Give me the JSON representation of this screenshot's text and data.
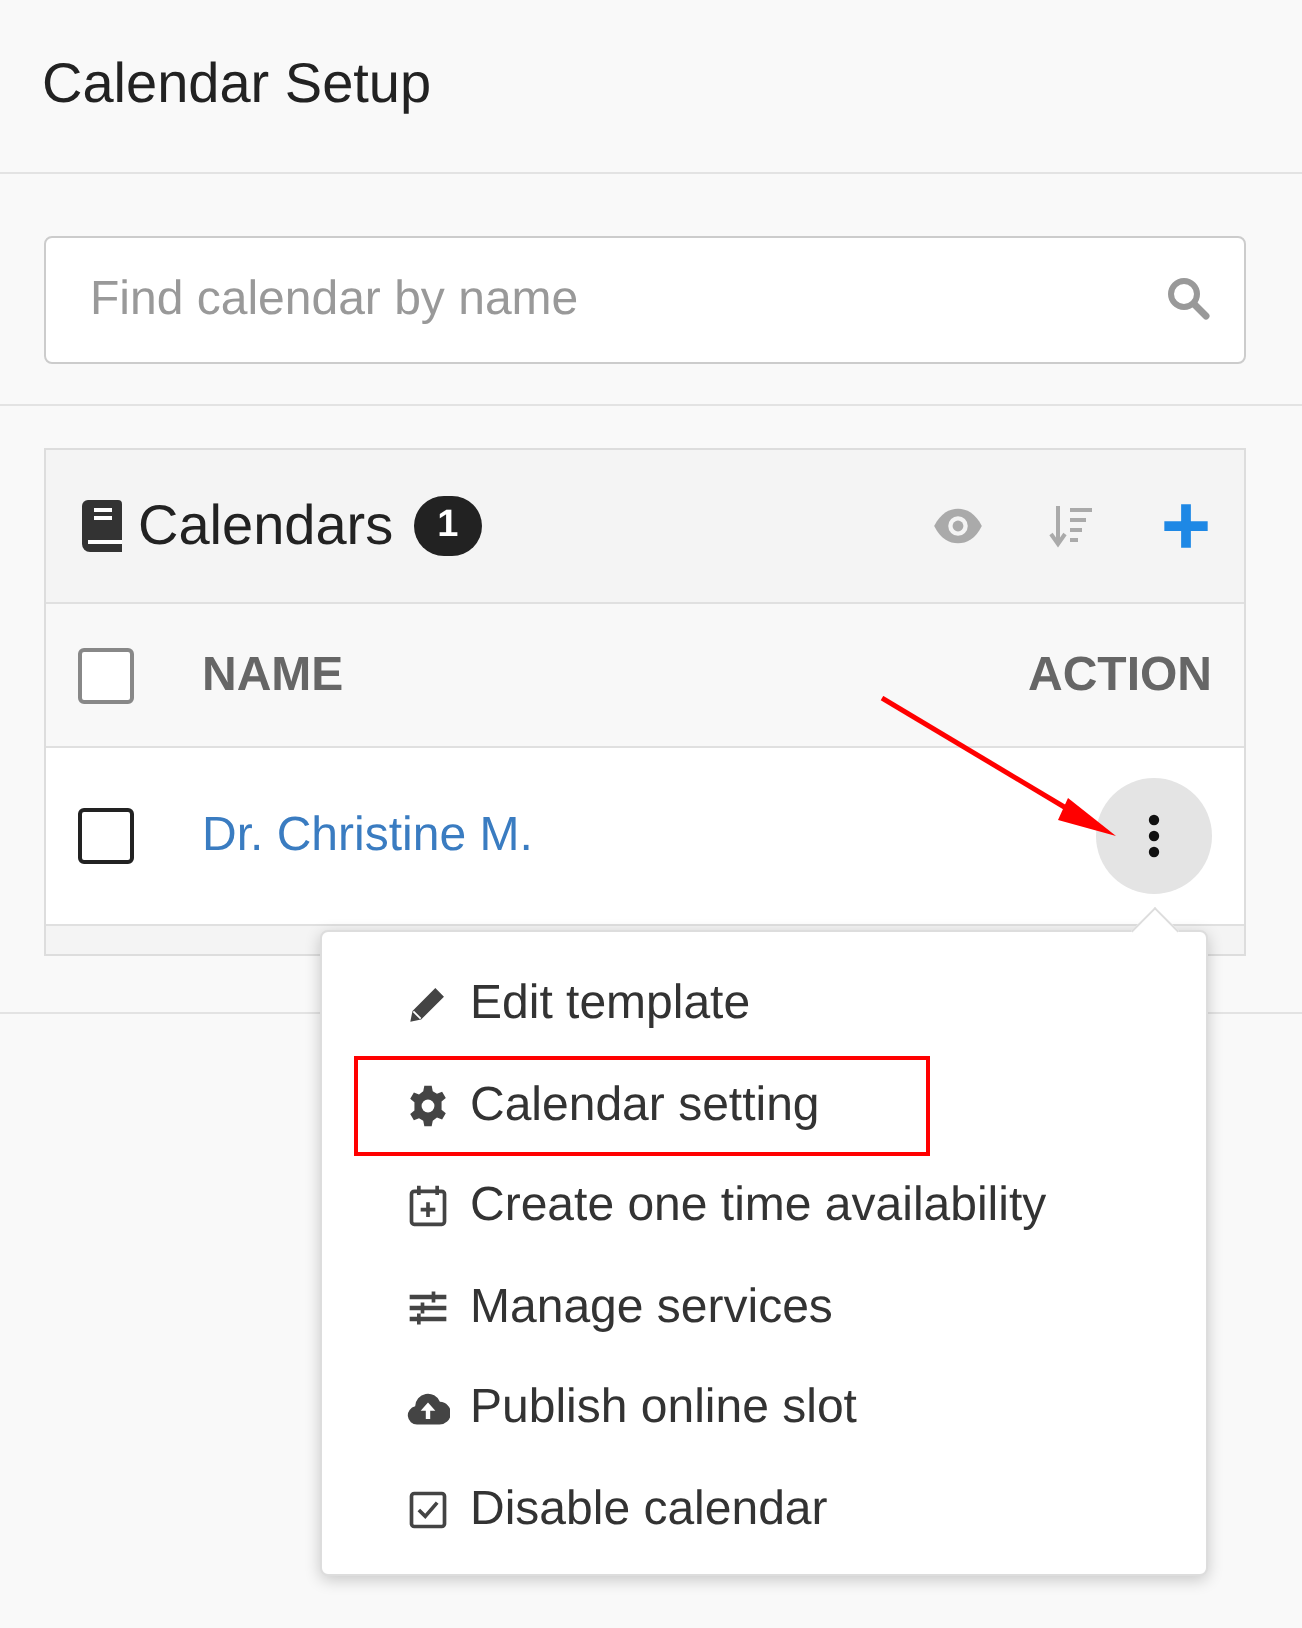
{
  "page_title": "Calendar Setup",
  "search": {
    "placeholder": "Find calendar by name"
  },
  "calendars": {
    "title": "Calendars",
    "count": "1",
    "columns": [
      {
        "label": "NAME"
      },
      {
        "label": "ACTION"
      }
    ],
    "header_checkbox": {
      "checked": false
    },
    "rows": [
      {
        "name": "Dr. Christine M.",
        "checked": false,
        "menu_open": true
      }
    ]
  },
  "action_menu": {
    "items": [
      {
        "kind": "edit",
        "label": "Edit template",
        "highlighted": false
      },
      {
        "kind": "settings",
        "label": "Calendar setting",
        "highlighted": true
      },
      {
        "kind": "create",
        "label": "Create one time availability",
        "highlighted": false
      },
      {
        "kind": "manage",
        "label": "Manage services",
        "highlighted": false
      },
      {
        "kind": "publish",
        "label": "Publish online slot",
        "highlighted": false
      },
      {
        "kind": "disable",
        "label": "Disable calendar",
        "highlighted": false
      }
    ]
  }
}
